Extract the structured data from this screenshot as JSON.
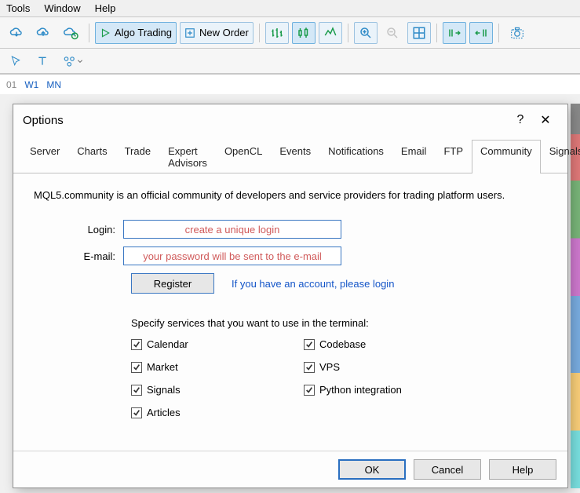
{
  "menubar": {
    "tools": "Tools",
    "window": "Window",
    "help": "Help"
  },
  "toolbar": {
    "algo_label": "Algo Trading",
    "new_order_label": "New Order"
  },
  "timeframes": {
    "tf01": "01",
    "w1": "W1",
    "mn": "MN"
  },
  "dialog": {
    "title": "Options",
    "help_symbol": "?",
    "close_symbol": "✕",
    "tabs": [
      "Server",
      "Charts",
      "Trade",
      "Expert Advisors",
      "OpenCL",
      "Events",
      "Notifications",
      "Email",
      "FTP",
      "Community",
      "Signals"
    ],
    "active_tab_index": 9,
    "intro": "MQL5.community is an official community of developers and service providers for trading platform users.",
    "login_label": "Login:",
    "login_placeholder": "create a unique login",
    "email_label": "E-mail:",
    "email_placeholder": "your password will be sent to the e-mail",
    "register_label": "Register",
    "login_link": "If you have an account, please login",
    "services_label": "Specify services that you want to use in the terminal:",
    "checks": {
      "calendar": "Calendar",
      "codebase": "Codebase",
      "market": "Market",
      "vps": "VPS",
      "signals": "Signals",
      "python": "Python integration",
      "articles": "Articles"
    },
    "buttons": {
      "ok": "OK",
      "cancel": "Cancel",
      "help": "Help"
    }
  }
}
